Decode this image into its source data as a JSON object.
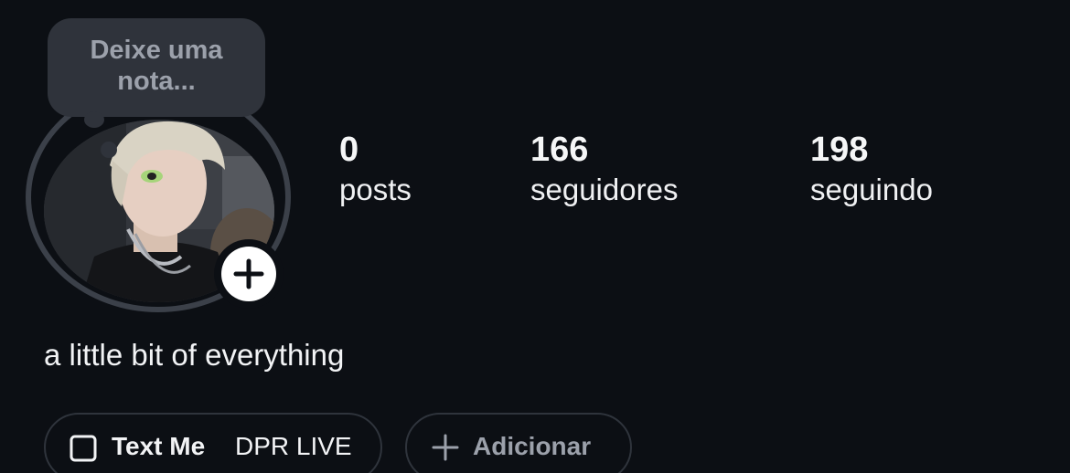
{
  "note": {
    "placeholder_line1": "Deixe uma",
    "placeholder_line2": "nota..."
  },
  "stats": {
    "posts": {
      "value": "0",
      "label": "posts"
    },
    "followers": {
      "value": "166",
      "label": "seguidores"
    },
    "following": {
      "value": "198",
      "label": "seguindo"
    }
  },
  "bio": "a little bit of everything",
  "buttons": {
    "link_title": "Text Me",
    "link_subtitle": "DPR LIVE",
    "add_label": "Adicionar"
  },
  "icons": {
    "add_story": "plus-icon",
    "link": "square-outline-icon",
    "add": "plus-icon"
  },
  "colors": {
    "background": "#0c0f14",
    "ring": "#3b4049",
    "note_bubble": "#2f333b",
    "muted_text": "#9ca1ab"
  }
}
